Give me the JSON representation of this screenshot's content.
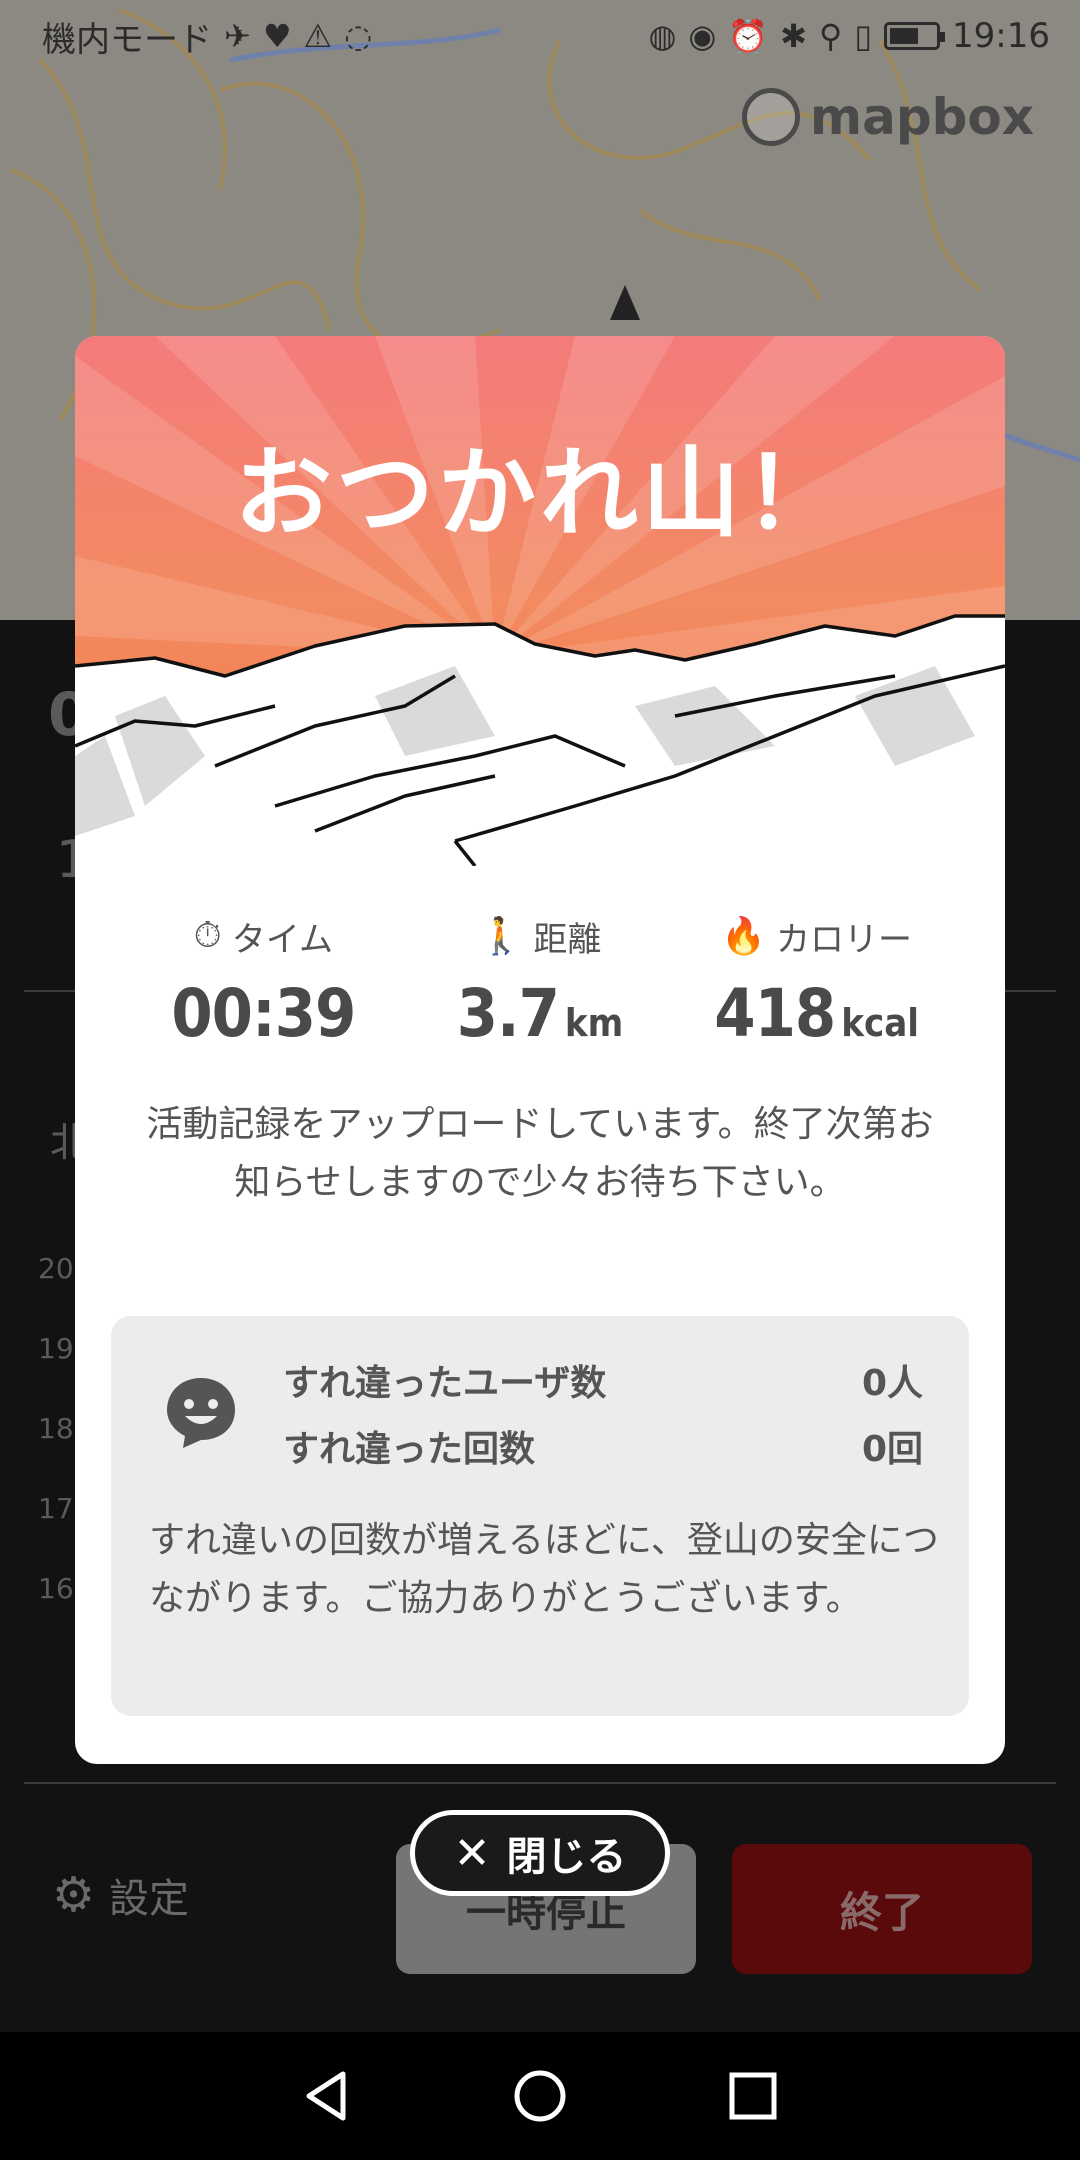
{
  "status_bar": {
    "left_text": "機内モード",
    "time": "19:16",
    "icons_left": [
      "airplane-icon",
      "heart-icon",
      "warning-icon",
      "sync-icon",
      "app-icon"
    ],
    "icons_right": [
      "nfc-icon",
      "eye-icon",
      "alarm-icon",
      "bluetooth-icon",
      "location-icon",
      "vibrate-icon",
      "battery-icon"
    ]
  },
  "map": {
    "attribution": "mapbox"
  },
  "modal": {
    "title": "おつかれ山！",
    "stats": [
      {
        "label": "タイム",
        "value": "00:39",
        "unit": "",
        "icon": "stopwatch-icon"
      },
      {
        "label": "距離",
        "value": "3.7",
        "unit": "km",
        "icon": "hiker-icon"
      },
      {
        "label": "カロリー",
        "value": "418",
        "unit": "kcal",
        "icon": "flame-icon"
      }
    ],
    "upload_message": "活動記録をアップロードしています。終了次第お知らせしますので少々お待ち下さい。",
    "pass": {
      "users_label": "すれ違ったユーザ数",
      "users_value": "0人",
      "count_label": "すれ違った回数",
      "count_value": "0回",
      "note": "すれ違いの回数が増えるほどに、登山の安全につながります。ご協力ありがとうございます。"
    }
  },
  "actions": {
    "close_label": "閉じる",
    "settings_label": "設定",
    "pause_label": "一時停止",
    "end_label": "終了"
  },
  "under_panel": {
    "frag_top": "0",
    "frag_second": "1",
    "frag_north": "北",
    "chart_ticks": [
      "20",
      "19",
      "18",
      "17",
      "16"
    ]
  },
  "colors": {
    "hero_top": "#f47b7b",
    "hero_bottom": "#f27a40",
    "end_button": "#5a0a0a",
    "pause_button": "#757575"
  }
}
